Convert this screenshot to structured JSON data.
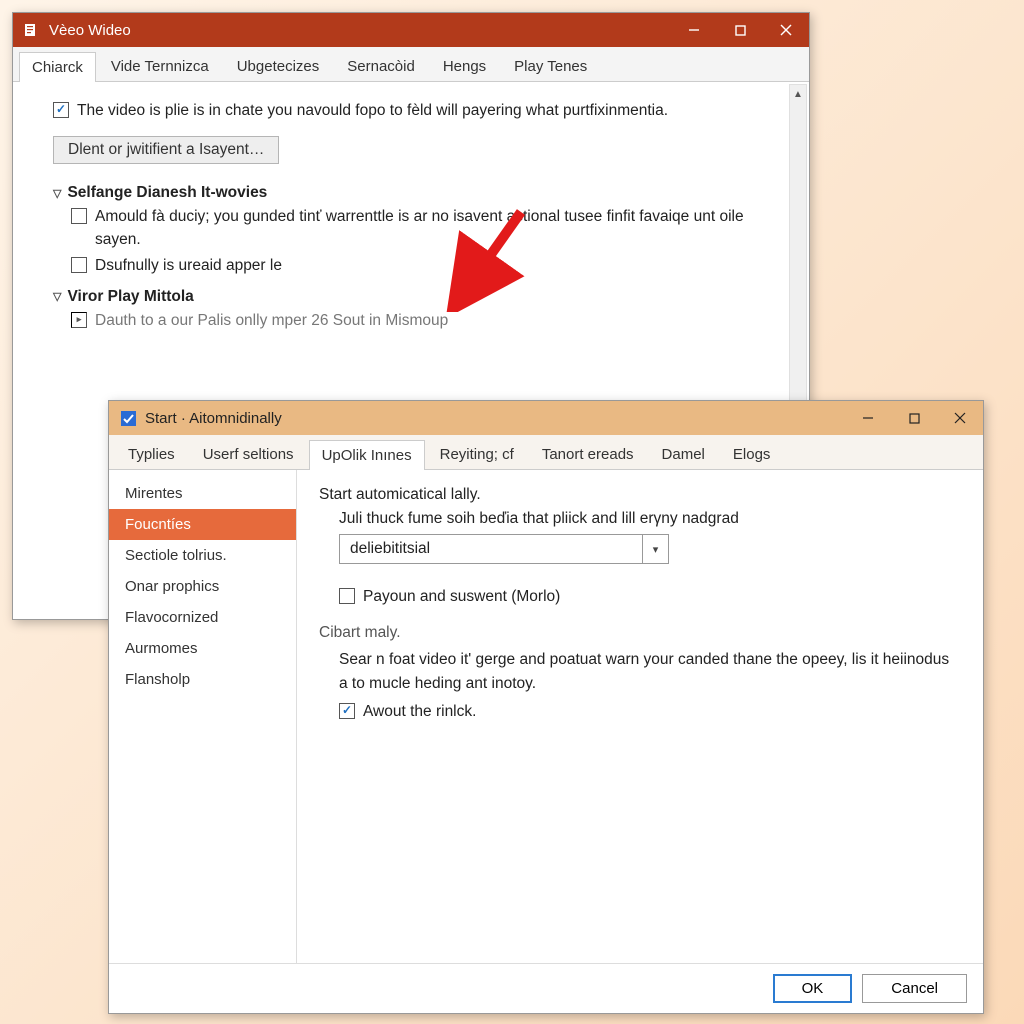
{
  "win1": {
    "title": "Vèeo Wideo",
    "tabs": [
      "Chiarck",
      "Vide Ternnizca",
      "Ubgetecizes",
      "Sernacòid",
      "Hengs",
      "Play Tenes"
    ],
    "active_tab": 0,
    "check1": "The video is plie is in chate you navould fopo to fèld will payering what purtfixinmentia.",
    "btn1": "Dlent or jwitifient a Isayent…",
    "group1_title": "Selfange Dianesh It-wovies",
    "group1_check1": "Amould fà duciy; you gunded tinť warrenttle is ar no isavent actional tusee finfit favaiqe unt oile sayen.",
    "group1_check2": "Dsufnully is ureaid apper le",
    "group2_title": "Viror Play Mittola",
    "group2_radio1": "Dauth to a our Palis onlly mper 26 Sout in Mismoup"
  },
  "win2": {
    "title": "Start · Aitomnidinally",
    "tabs": [
      "Typlies",
      "Userf seltions",
      "UpOlik Inınes",
      "Reyiting; cf",
      "Tanort ereads",
      "Damel",
      "Elogs"
    ],
    "active_tab": 2,
    "sidebar": [
      "Mirentes",
      "Foucntíes",
      "Sectiole tolrius.",
      "Onar prophics",
      "Flavocornized",
      "Aurmomes",
      "Flansholp"
    ],
    "sidebar_active": 1,
    "heading": "Start automicatical lally.",
    "desc1": "Juli thuck fume soih beďia that pliick and lill erγny nadgrad",
    "combo_value": "deliebititsial",
    "check1": "Payoun and suswent (Morlo)",
    "section2": "Cibart maly.",
    "desc2": "Sear n foat video it' gerge and poatuat warn your canded thane the opeey, lis it heiinodus a to mucle heding ant inotoy.",
    "check2": "Awout the rinlck.",
    "ok": "OK",
    "cancel": "Cancel"
  }
}
